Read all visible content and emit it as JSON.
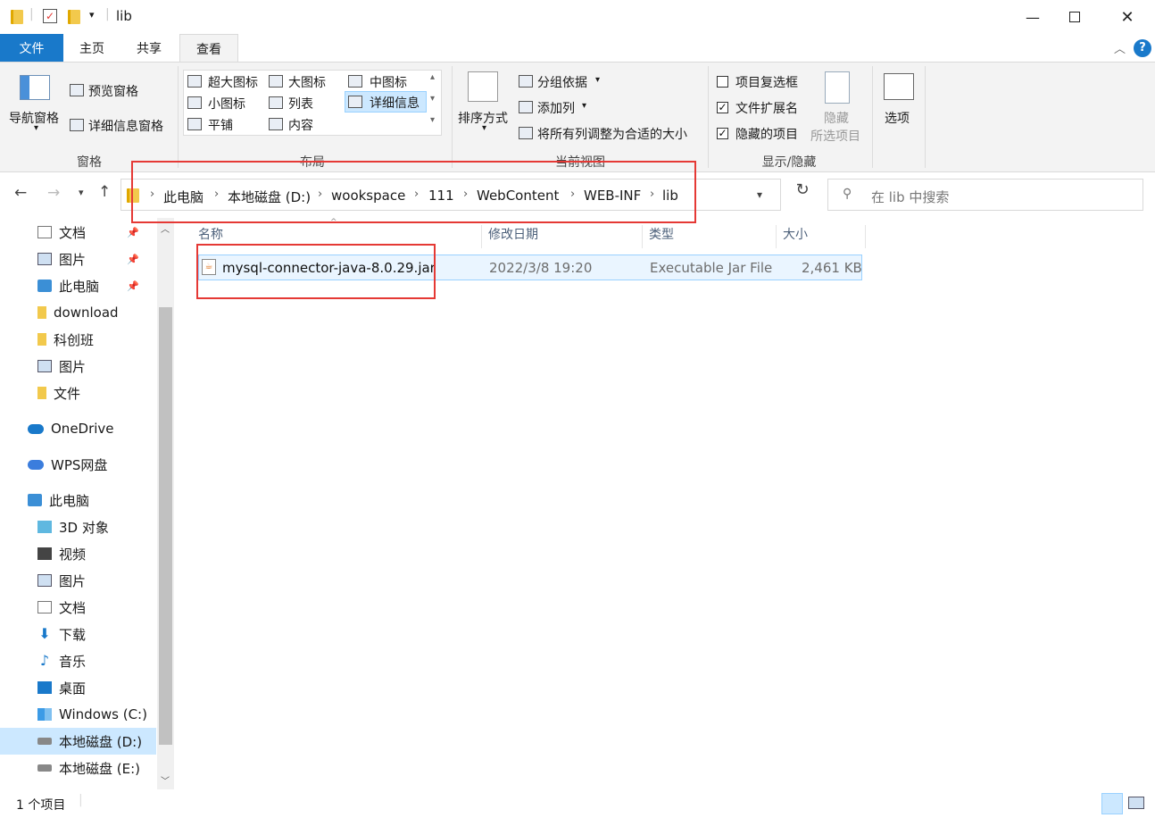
{
  "window": {
    "title": "lib"
  },
  "tabs": [
    {
      "label": "文件"
    },
    {
      "label": "主页"
    },
    {
      "label": "共享"
    },
    {
      "label": "查看"
    }
  ],
  "ribbon": {
    "pane_group": {
      "label": "窗格",
      "nav_pane": "导航窗格",
      "preview_pane": "预览窗格",
      "details_pane": "详细信息窗格"
    },
    "layout_group": {
      "label": "布局",
      "items": [
        "超大图标",
        "大图标",
        "中图标",
        "小图标",
        "列表",
        "详细信息",
        "平铺",
        "内容"
      ]
    },
    "current_view_group": {
      "label": "当前视图",
      "sort_by": "排序方式",
      "group_by": "分组依据",
      "add_column": "添加列",
      "fit_columns": "将所有列调整为合适的大小"
    },
    "show_hide_group": {
      "label": "显示/隐藏",
      "item_checkboxes": {
        "label": "项目复选框",
        "checked": false
      },
      "file_extensions": {
        "label": "文件扩展名",
        "checked": true
      },
      "hidden_items": {
        "label": "隐藏的项目",
        "checked": true
      },
      "hide_selected_line1": "隐藏",
      "hide_selected_line2": "所选项目"
    },
    "options": "选项"
  },
  "address": {
    "crumbs": [
      "此电脑",
      "本地磁盘 (D:)",
      "wookspace",
      "111",
      "WebContent",
      "WEB-INF",
      "lib"
    ],
    "search_placeholder": "在 lib 中搜索"
  },
  "nav": {
    "quick": [
      {
        "label": "文档",
        "icon": "document-icon",
        "pinned": true
      },
      {
        "label": "图片",
        "icon": "picture-icon",
        "pinned": true
      },
      {
        "label": "此电脑",
        "icon": "computer-icon",
        "pinned": true
      },
      {
        "label": "download",
        "icon": "folder-icon",
        "pinned": false
      },
      {
        "label": "科创班",
        "icon": "folder-icon",
        "pinned": false
      },
      {
        "label": "图片",
        "icon": "picture-icon",
        "pinned": false
      },
      {
        "label": "文件",
        "icon": "folder-icon",
        "pinned": false
      }
    ],
    "onedrive": "OneDrive",
    "wps": "WPS网盘",
    "this_pc": "此电脑",
    "pc_items": [
      {
        "label": "3D 对象",
        "icon": "cube-icon"
      },
      {
        "label": "视频",
        "icon": "video-icon"
      },
      {
        "label": "图片",
        "icon": "picture-icon"
      },
      {
        "label": "文档",
        "icon": "document-icon"
      },
      {
        "label": "下载",
        "icon": "download-icon"
      },
      {
        "label": "音乐",
        "icon": "music-icon"
      },
      {
        "label": "桌面",
        "icon": "desktop-icon"
      },
      {
        "label": "Windows (C:)",
        "icon": "windows-drive-icon"
      },
      {
        "label": "本地磁盘 (D:)",
        "icon": "drive-icon"
      },
      {
        "label": "本地磁盘 (E:)",
        "icon": "drive-icon"
      }
    ]
  },
  "columns": {
    "name": "名称",
    "modified": "修改日期",
    "type": "类型",
    "size": "大小"
  },
  "files": [
    {
      "name": "mysql-connector-java-8.0.29.jar",
      "modified": "2022/3/8 19:20",
      "type": "Executable Jar File",
      "size": "2,461 KB"
    }
  ],
  "status": {
    "count": "1 个项目"
  },
  "colors": {
    "accent": "#1979ca",
    "highlight": "#e53935",
    "selection": "#cce8ff"
  }
}
